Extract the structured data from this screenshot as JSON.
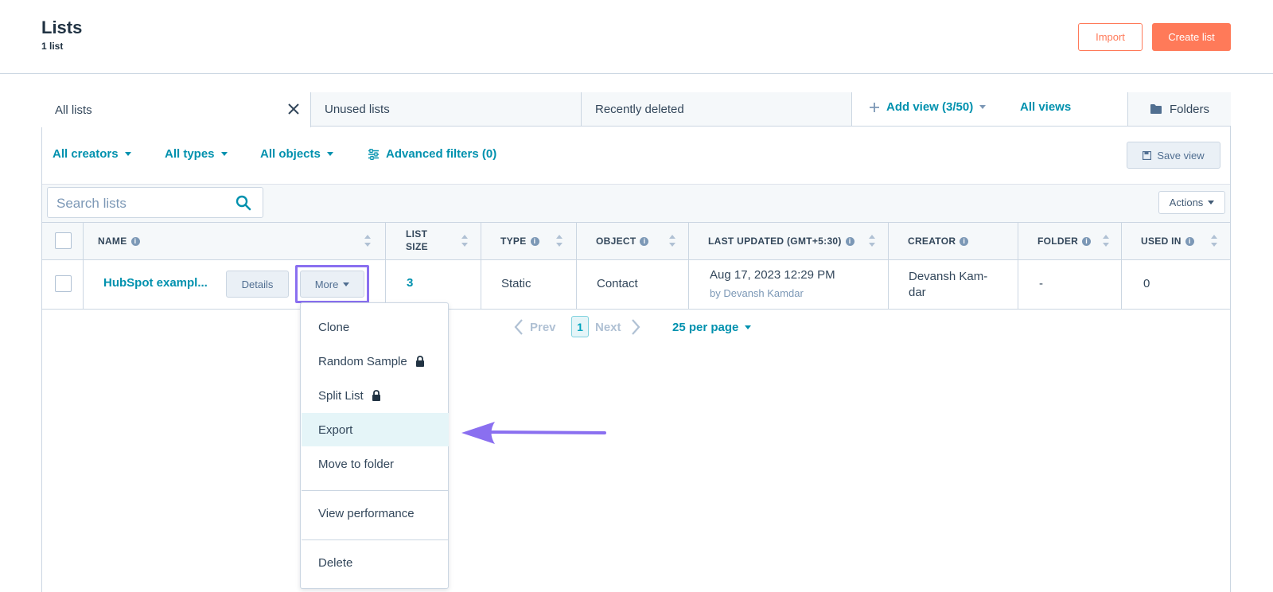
{
  "header": {
    "title": "Lists",
    "count": "1 list",
    "import_label": "Import",
    "create_label": "Create list"
  },
  "tabs": [
    {
      "label": "All lists"
    },
    {
      "label": "Unused lists"
    },
    {
      "label": "Recently deleted"
    }
  ],
  "view_controls": {
    "add_view": "Add view (3/50)",
    "all_views": "All views",
    "folders": "Folders"
  },
  "filters": {
    "creators": "All creators",
    "types": "All types",
    "objects": "All objects",
    "advanced": "Advanced filters (0)",
    "save_view": "Save view"
  },
  "search": {
    "placeholder": "Search lists"
  },
  "actions_label": "Actions",
  "table": {
    "columns": [
      {
        "label": "NAME"
      },
      {
        "label": "LIST SIZE",
        "line1": "LIST",
        "line2": "SIZE"
      },
      {
        "label": "TYPE"
      },
      {
        "label": "OBJECT"
      },
      {
        "label": "LAST UPDATED (GMT+5:30)"
      },
      {
        "label": "CREATOR"
      },
      {
        "label": "FOLDER"
      },
      {
        "label": "USED IN"
      }
    ],
    "rows": [
      {
        "name": "HubSpot exampl...",
        "details_label": "Details",
        "more_label": "More",
        "list_size": "3",
        "type": "Static",
        "object": "Contact",
        "last_updated": "Aug 17, 2023 12:29 PM",
        "updated_by": "by Devansh Kamdar",
        "creator": "Devansh Kam-dar",
        "folder": "-",
        "used_in": "0"
      }
    ]
  },
  "pagination": {
    "prev": "Prev",
    "current_page": "1",
    "next": "Next",
    "per_page": "25 per page"
  },
  "more_menu": {
    "items": [
      {
        "label": "Clone"
      },
      {
        "label": "Random Sample",
        "locked": true
      },
      {
        "label": "Split List",
        "locked": true
      },
      {
        "label": "Export",
        "highlighted": true
      },
      {
        "label": "Move to folder"
      },
      {
        "label": "View performance"
      },
      {
        "label": "Delete"
      }
    ]
  },
  "colors": {
    "accent": "#0091ae",
    "brand": "#ff7a59",
    "highlight_border": "#8a6ff0",
    "annotation_arrow": "#8a6ff0"
  }
}
